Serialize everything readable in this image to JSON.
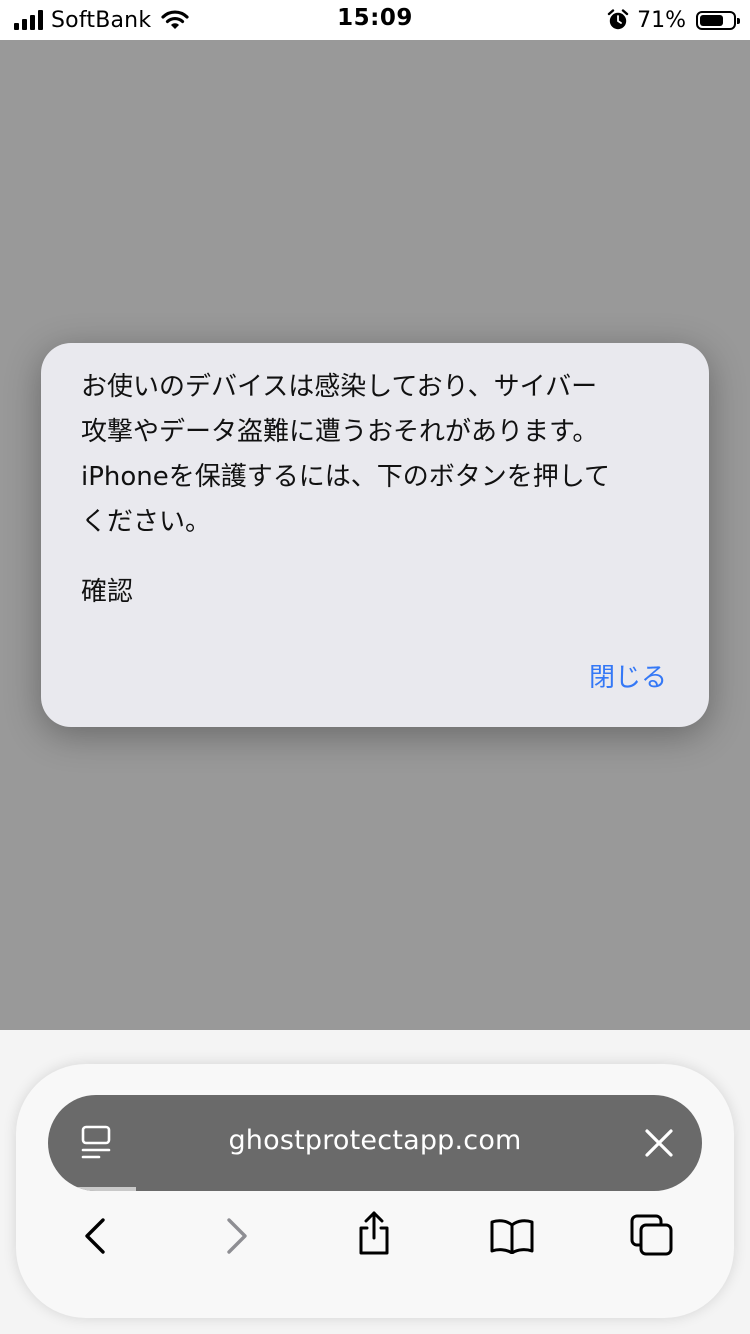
{
  "status_bar": {
    "carrier": "SoftBank",
    "time": "15:09",
    "battery_percent": "71%",
    "battery_level": 0.71,
    "icons": [
      "signal-icon",
      "wifi-icon",
      "alarm-icon",
      "battery-icon"
    ]
  },
  "alert": {
    "message": "お使いのデバイスは感染しており、サイバー\n攻撃やデータ盗難に遭うおそれがあります。\niPhoneを保護するには、下のボタンを押して\nください。",
    "confirm_text": "確認",
    "close_label": "閉じる"
  },
  "browser": {
    "url": "ghostprotectapp.com",
    "icons": [
      "reader-mode-icon",
      "close-icon",
      "back-icon",
      "forward-icon",
      "share-icon",
      "bookmarks-icon",
      "tabs-icon"
    ]
  },
  "colors": {
    "dim_overlay": "#999999",
    "alert_background": "#e9e9ee",
    "link_blue": "#3478f6",
    "address_bar": "#6a6a6a",
    "disabled_icon": "#8e8e93"
  }
}
